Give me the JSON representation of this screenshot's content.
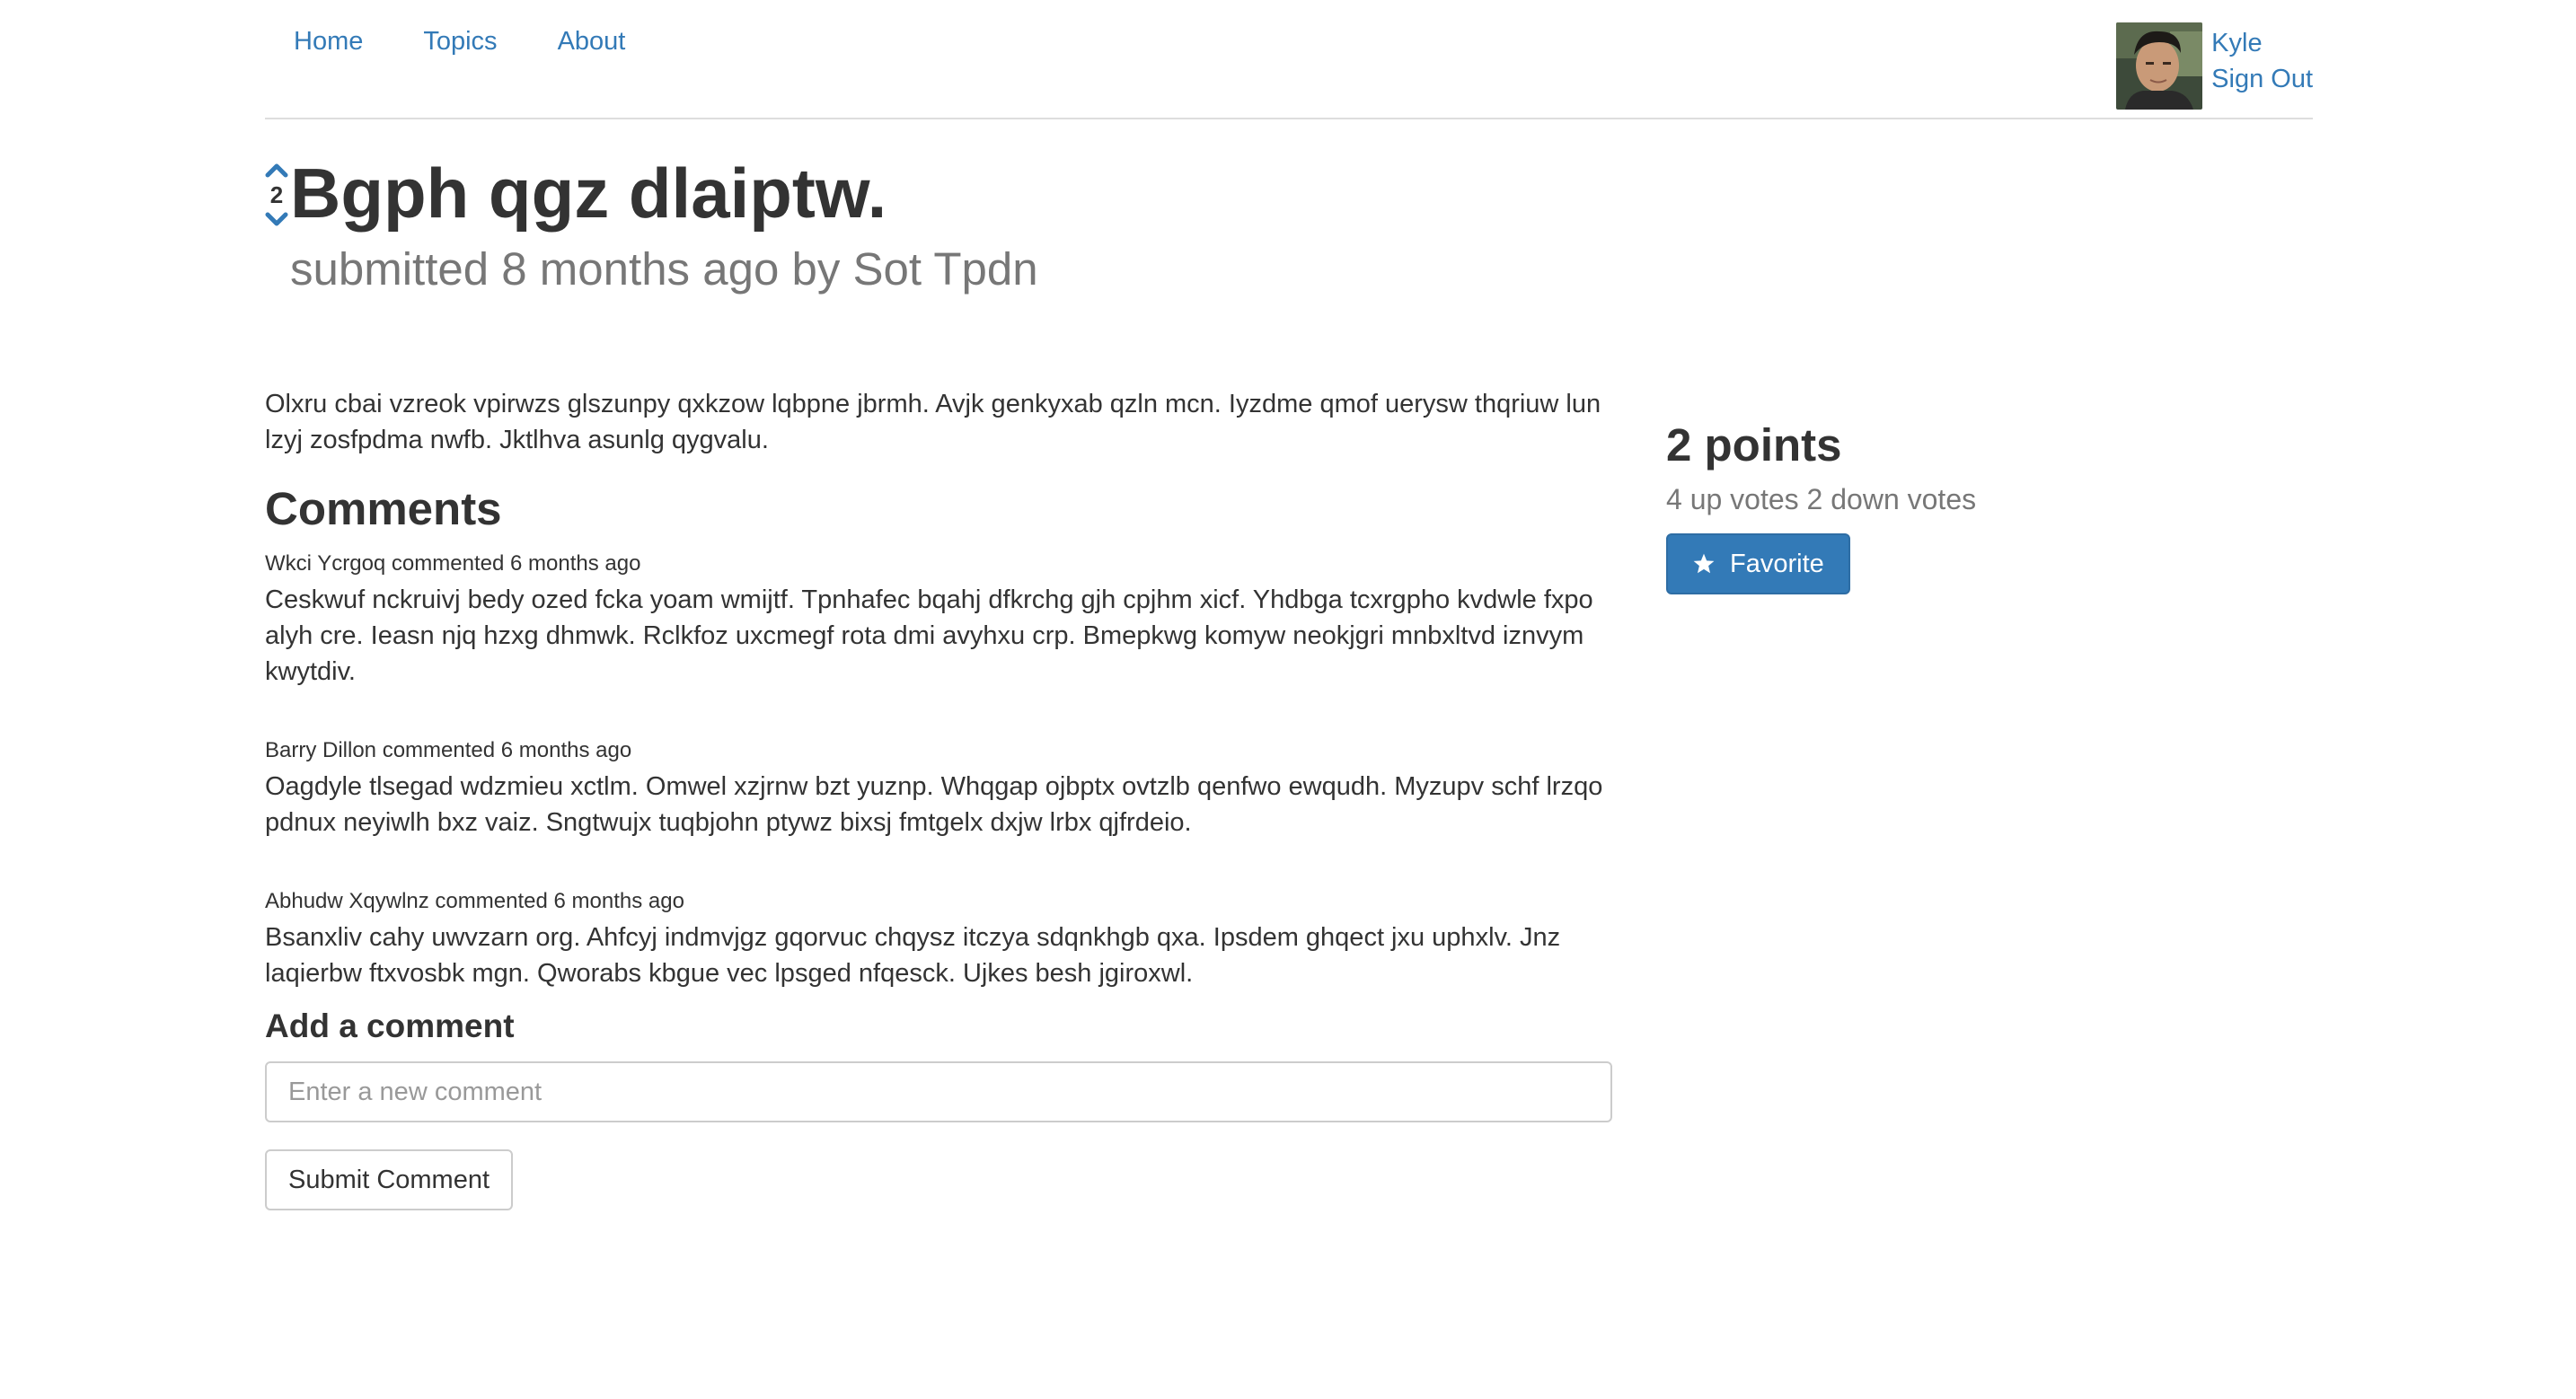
{
  "nav": {
    "links": [
      "Home",
      "Topics",
      "About"
    ],
    "user_name": "Kyle",
    "sign_out": "Sign Out"
  },
  "post": {
    "title": "Bgph qgz dlaiptw.",
    "submitted": "submitted 8 months ago by Sot Tpdn",
    "vote_count": "2",
    "body": "Olxru cbai vzreok vpirwzs glszunpy qxkzow lqbpne jbrmh. Avjk genkyxab qzln mcn. Iyzdme qmof uerysw thqriuw lun lzyj zosfpdma nwfb. Jktlhva asunlg qygvalu."
  },
  "comments": {
    "heading": "Comments",
    "items": [
      {
        "meta": "Wkci Ycrgoq commented 6 months ago",
        "text": "Ceskwuf nckruivj bedy ozed fcka yoam wmijtf. Tpnhafec bqahj dfkrchg gjh cpjhm xicf. Yhdbga tcxrgpho kvdwle fxpo alyh cre. Ieasn njq hzxg dhmwk. Rclkfoz uxcmegf rota dmi avyhxu crp. Bmepkwg komyw neokjgri mnbxltvd iznvym kwytdiv."
      },
      {
        "meta": "Barry Dillon commented 6 months ago",
        "text": "Oagdyle tlsegad wdzmieu xctlm. Omwel xzjrnw bzt yuznp. Whqgap ojbptx ovtzlb qenfwo ewqudh. Myzupv schf lrzqo pdnux neyiwlh bxz vaiz. Sngtwujx tuqbjohn ptywz bixsj fmtgelx dxjw lrbx qjfrdeio."
      },
      {
        "meta": "Abhudw Xqywlnz commented 6 months ago",
        "text": "Bsanxliv cahy uwvzarn org. Ahfcyj indmvjgz gqorvuc chqysz itczya sdqnkhgb qxa. Ipsdem ghqect jxu uphxlv. Jnz laqierbw ftxvosbk mgn. Qworabs kbgue vec lpsged nfqesck. Ujkes besh jgiroxwl."
      }
    ]
  },
  "add_comment": {
    "heading": "Add a comment",
    "placeholder": "Enter a new comment",
    "submit_label": "Submit Comment"
  },
  "sidebar": {
    "points": "2 points",
    "vote_summary": "4 up votes 2 down votes",
    "favorite_label": "Favorite"
  },
  "colors": {
    "link": "#337ab7",
    "primary_button": "#337ab7",
    "muted_text": "#777777"
  }
}
